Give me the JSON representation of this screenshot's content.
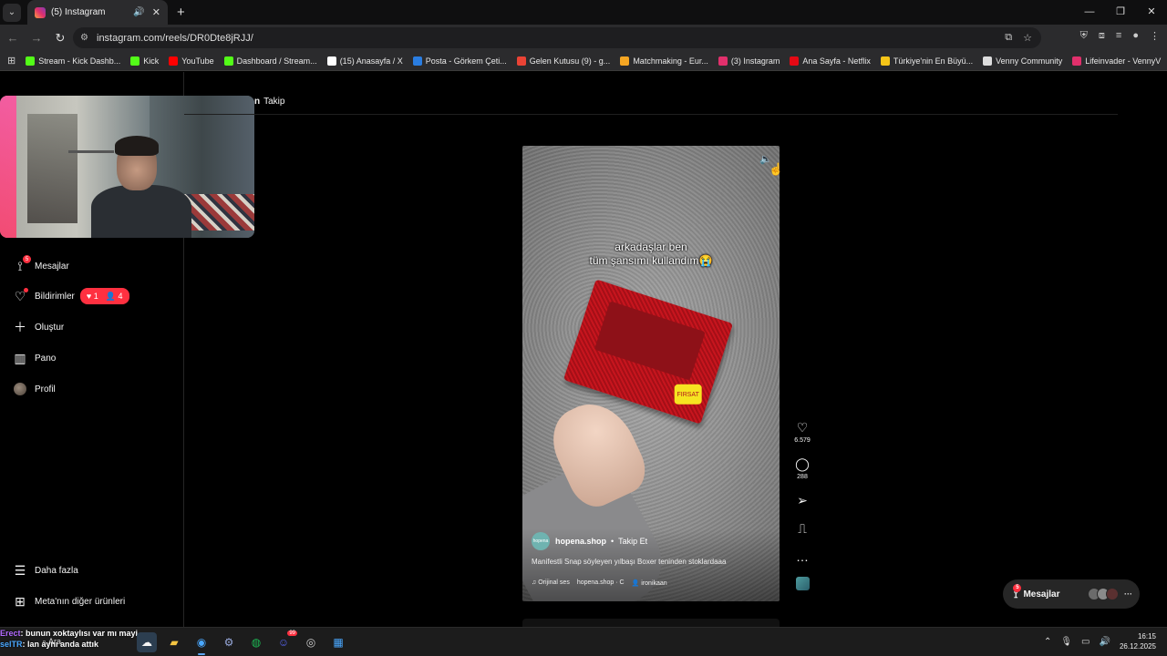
{
  "browser": {
    "tab_title": "(5) Instagram",
    "url": "instagram.com/reels/DR0Dte8jRJJ/",
    "bookmarks": [
      {
        "label": "Stream - Kick Dashb...",
        "color": "#53fc18"
      },
      {
        "label": "Kick",
        "color": "#53fc18"
      },
      {
        "label": "YouTube",
        "color": "#ff0000"
      },
      {
        "label": "Dashboard / Stream...",
        "color": "#53fc18"
      },
      {
        "label": "(15) Anasayfa / X",
        "color": "#ffffff"
      },
      {
        "label": "Posta - Görkem Çeti...",
        "color": "#2a7de1"
      },
      {
        "label": "Gelen Kutusu (9) - g...",
        "color": "#ea4335"
      },
      {
        "label": "Matchmaking - Eur...",
        "color": "#f5a623"
      },
      {
        "label": "(3) Instagram",
        "color": "#e1306c"
      },
      {
        "label": "Ana Sayfa - Netflix",
        "color": "#e50914"
      },
      {
        "label": "Türkiye'nin En Büyü...",
        "color": "#f5c518"
      },
      {
        "label": "Venny Community",
        "color": "#dddddd"
      },
      {
        "label": "Lifeinvader - VennyV",
        "color": "#e1306c"
      }
    ]
  },
  "top_tabs": {
    "takip_prefix": "n",
    "takip": "Takip"
  },
  "sidebar": {
    "items": [
      {
        "label": "Mesajlar",
        "badge": "5"
      },
      {
        "label": "Bildirimler",
        "likes": "1",
        "follows": "4"
      },
      {
        "label": "Oluştur"
      },
      {
        "label": "Pano"
      },
      {
        "label": "Profil"
      }
    ],
    "bottom": [
      {
        "label": "Daha fazla"
      },
      {
        "label": "Meta'nın diğer ürünleri"
      }
    ]
  },
  "reel": {
    "overlay_line1": "arkadaşlar ben",
    "overlay_line2": "tüm şansımı kullandım😭",
    "sticker": "FIRSAT",
    "author_pfp": "hopena",
    "author": "hopena.shop",
    "follow": "Takip Et",
    "description": "Manifestli Snap söyleyen yılbaşı Boxer teninden stoklardaaa",
    "audio": "Orijinal ses",
    "audio_author": "hopena.shop · C",
    "tagged": "ironikaan"
  },
  "actions": {
    "likes": "6.579",
    "comments": "288"
  },
  "messages_float": {
    "label": "Mesajlar",
    "badge": "5"
  },
  "chat": [
    {
      "user": "Erect",
      "text": ": bunun xoktaylısı var mı mayi"
    },
    {
      "user": "selTR",
      "text": ": lan aynı anda attık"
    }
  ],
  "taskbar": {
    "search_label": "Ara",
    "discord_badge": "99",
    "time": "16:15",
    "date": "26.12.2025"
  }
}
